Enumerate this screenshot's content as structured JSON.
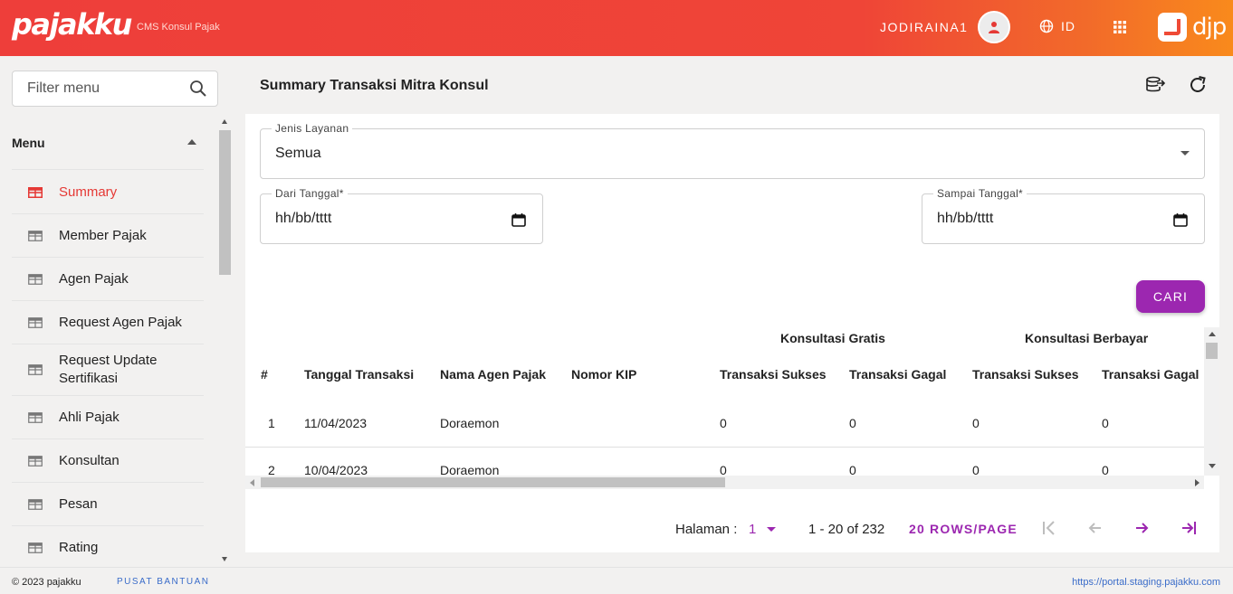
{
  "header": {
    "logo": "pajakku",
    "subtitle": "CMS Konsul Pajak",
    "username": "JODIRAINA1",
    "lang": "ID",
    "brand": "djp",
    "gradient": [
      "#ee3e3a",
      "#f98a1c"
    ]
  },
  "sidebar": {
    "filter_placeholder": "Filter menu",
    "menu_title": "Menu",
    "items": [
      {
        "label": "Summary",
        "active": true
      },
      {
        "label": "Member Pajak"
      },
      {
        "label": "Agen Pajak"
      },
      {
        "label": "Request Agen Pajak"
      },
      {
        "label": "Request Update Sertifikasi"
      },
      {
        "label": "Ahli Pajak"
      },
      {
        "label": "Konsultan"
      },
      {
        "label": "Pesan"
      },
      {
        "label": "Rating"
      }
    ]
  },
  "main": {
    "title": "Summary Transaksi Mitra Konsul",
    "form": {
      "jenis_label": "Jenis Layanan",
      "jenis_value": "Semua",
      "dari_label": "Dari Tanggal*",
      "dari_value": "hh/bb/tttt",
      "sampai_label": "Sampai Tanggal*",
      "sampai_value": "hh/bb/tttt",
      "search_button": "CARI"
    },
    "table": {
      "group_gratis": "Konsultasi Gratis",
      "group_berbayar": "Konsultasi Berbayar",
      "columns": [
        "#",
        "Tanggal Transaksi",
        "Nama Agen Pajak",
        "Nomor KIP",
        "Transaksi Sukses",
        "Transaksi Gagal",
        "Transaksi Sukses",
        "Transaksi Gagal"
      ],
      "rows": [
        [
          "1",
          "11/04/2023",
          "Doraemon",
          "",
          "0",
          "0",
          "0",
          "0"
        ],
        [
          "2",
          "10/04/2023",
          "Doraemon",
          "",
          "0",
          "0",
          "0",
          "0"
        ]
      ]
    },
    "pagination": {
      "label": "Halaman :",
      "page": "1",
      "range": "1 - 20 of 232",
      "rows_per_page": "20 ROWS/PAGE"
    }
  },
  "footer": {
    "copyright": "© 2023 pajakku",
    "help": "PUSAT BANTUAN",
    "url": "https://portal.staging.pajakku.com"
  },
  "colors": {
    "accent": "#9c27b0",
    "active": "#e53935"
  }
}
